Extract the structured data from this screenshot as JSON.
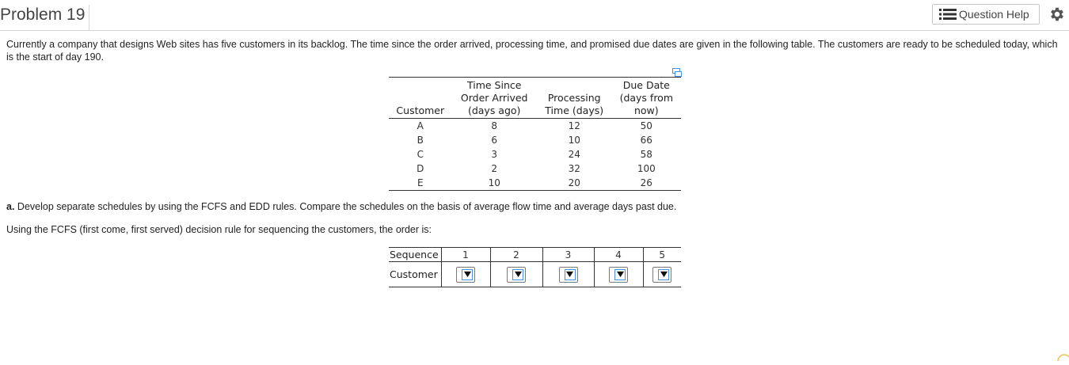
{
  "header": {
    "title": "Problem 19",
    "question_help_label": "Question Help",
    "icons": [
      "list-icon",
      "gear-icon"
    ]
  },
  "intro": {
    "text": "Currently a company that designs Web sites has five customers in its backlog. The time since the order arrived, processing time, and promised due dates are given in the following table. The customers are ready to be scheduled today, which is the start of day 190."
  },
  "data_table": {
    "headers": {
      "customer": "Customer",
      "time_since_l1": "Time Since",
      "time_since_l2": "Order Arrived",
      "time_since_l3": "(days ago)",
      "proc_l1": "Processing",
      "proc_l2": "Time (days)",
      "due_l1": "Due Date",
      "due_l2": "(days from",
      "due_l3": "now)"
    },
    "rows": [
      {
        "customer": "A",
        "time_since": "8",
        "processing": "12",
        "due": "50"
      },
      {
        "customer": "B",
        "time_since": "6",
        "processing": "10",
        "due": "66"
      },
      {
        "customer": "C",
        "time_since": "3",
        "processing": "24",
        "due": "58"
      },
      {
        "customer": "D",
        "time_since": "2",
        "processing": "32",
        "due": "100"
      },
      {
        "customer": "E",
        "time_since": "10",
        "processing": "20",
        "due": "26"
      }
    ]
  },
  "question_a": {
    "label": "a.",
    "text": "Develop separate schedules by using the FCFS and EDD rules. Compare the schedules on the basis of average flow time and average days past due."
  },
  "fcfs_prompt": "Using the FCFS (first come, first served) decision rule for sequencing the customers, the order is:",
  "sequence_table": {
    "sequence_label": "Sequence",
    "customer_label": "Customer",
    "positions": [
      "1",
      "2",
      "3",
      "4",
      "5"
    ],
    "selected_values": [
      "",
      "",
      "",
      "",
      ""
    ]
  },
  "colors": {
    "accent_blue": "#4a90e2",
    "border": "#333333",
    "header_border": "#d6d6d6"
  }
}
